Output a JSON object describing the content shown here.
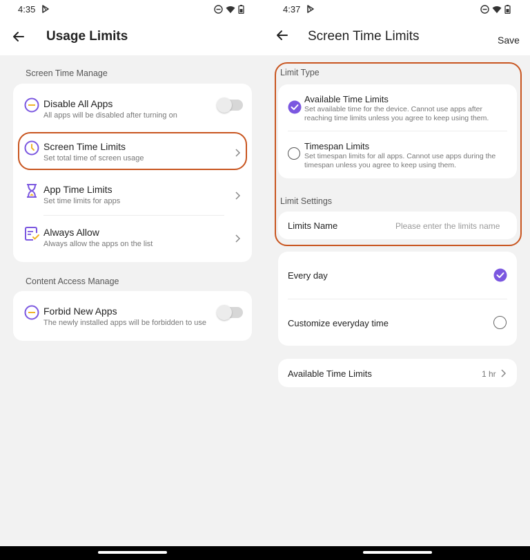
{
  "left": {
    "status": {
      "time": "4:35"
    },
    "header": {
      "title": "Usage Limits"
    },
    "sections": [
      {
        "label": "Screen Time Manage",
        "items": [
          {
            "title": "Disable All Apps",
            "subtitle": "All apps will be disabled after turning on",
            "icon": "minus-circle-icon",
            "control": "toggle-off"
          },
          {
            "title": "Screen Time Limits",
            "subtitle": "Set total time of screen usage",
            "icon": "clock-icon",
            "control": "chevron"
          },
          {
            "title": "App Time Limits",
            "subtitle": "Set time limits for apps",
            "icon": "hourglass-icon",
            "control": "chevron"
          },
          {
            "title": "Always Allow",
            "subtitle": "Always allow the apps on the list",
            "icon": "allow-list-icon",
            "control": "chevron"
          }
        ]
      },
      {
        "label": "Content Access Manage",
        "items": [
          {
            "title": "Forbid New Apps",
            "subtitle": "The newly installed apps will be forbidden to use",
            "icon": "minus-circle-icon",
            "control": "toggle-off"
          }
        ]
      }
    ]
  },
  "right": {
    "status": {
      "time": "4:37"
    },
    "header": {
      "title": "Screen Time Limits",
      "action": "Save"
    },
    "limit_type": {
      "label": "Limit Type",
      "options": [
        {
          "title": "Available Time Limits",
          "desc": "Set available time for the device. Cannot use apps after reaching time limits unless you agree to keep using them.",
          "selected": true
        },
        {
          "title": "Timespan Limits",
          "desc": "Set timespan limits for all apps. Cannot use apps during the timespan unless you agree to keep using them.",
          "selected": false
        }
      ]
    },
    "limit_settings": {
      "label": "Limit Settings",
      "name_label": "Limits Name",
      "name_placeholder": "Please enter the limits name"
    },
    "schedule": [
      {
        "label": "Every day",
        "selected": true
      },
      {
        "label": "Customize everyday time",
        "selected": false
      }
    ],
    "available_time": {
      "label": "Available Time Limits",
      "value": "1 hr"
    }
  },
  "colors": {
    "accent": "#7b57e0",
    "highlight": "#c8541e",
    "icon_yellow": "#f0b429"
  }
}
